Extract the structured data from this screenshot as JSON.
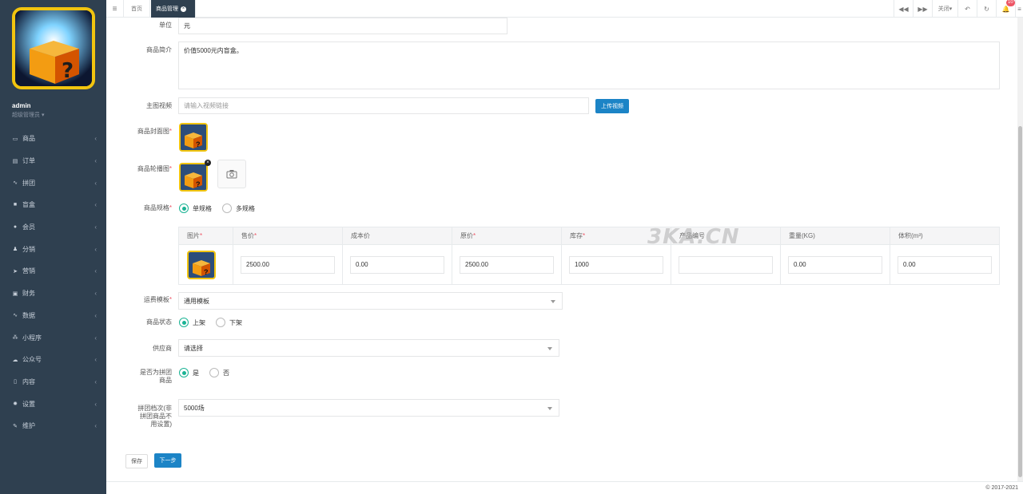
{
  "sidebar": {
    "user_name": "admin",
    "user_role": "超级管理员 ▾",
    "items": [
      {
        "label": "商品",
        "icon": "▭"
      },
      {
        "label": "订单",
        "icon": "▤"
      },
      {
        "label": "拼团",
        "icon": "∿"
      },
      {
        "label": "盲盒",
        "icon": "■"
      },
      {
        "label": "会员",
        "icon": "●"
      },
      {
        "label": "分销",
        "icon": "♟"
      },
      {
        "label": "营销",
        "icon": "➤"
      },
      {
        "label": "财务",
        "icon": "▣"
      },
      {
        "label": "数据",
        "icon": "∿"
      },
      {
        "label": "小程序",
        "icon": "⁂"
      },
      {
        "label": "公众号",
        "icon": "☁"
      },
      {
        "label": "内容",
        "icon": "▯"
      },
      {
        "label": "设置",
        "icon": "✹"
      },
      {
        "label": "维护",
        "icon": "✎"
      }
    ]
  },
  "topbar": {
    "menu_icon": "≡",
    "tab_home": "首页",
    "tab_active": "商品管理",
    "close_label": "关闭▾",
    "badge_count": "10"
  },
  "form": {
    "unit_label": "单位",
    "unit_value": "元",
    "intro_label": "商品简介",
    "intro_value": "价值5000元内盲盒。",
    "video_label": "主图视频",
    "video_placeholder": "请输入视频链接",
    "upload_video": "上传视频",
    "cover_label": "商品封面图",
    "carousel_label": "商品轮播图",
    "spec_label": "商品规格",
    "spec_single": "单规格",
    "spec_multi": "多规格",
    "shipping_label": "运费模板",
    "shipping_value": "通用模板",
    "status_label": "商品状态",
    "status_on": "上架",
    "status_off": "下架",
    "supplier_label": "供应商",
    "supplier_value": "请选择",
    "group_label_1": "是否为拼团",
    "group_label_2": "商品",
    "group_yes": "是",
    "group_no": "否",
    "tier_label_1": "拼团档次(非",
    "tier_label_2": "拼团商品不",
    "tier_label_3": "用设置)",
    "tier_value": "5000场",
    "save": "保存",
    "next": "下一步"
  },
  "spec_table": {
    "headers": [
      "图片",
      "售价",
      "成本价",
      "原价",
      "库存",
      "产品编号",
      "重量(KG)",
      "体积(m³)"
    ],
    "required": [
      true,
      true,
      false,
      true,
      true,
      false,
      false,
      false
    ],
    "values": [
      "2500.00",
      "0.00",
      "2500.00",
      "1000",
      "",
      "0.00",
      "0.00"
    ]
  },
  "watermark": "3KA.CN",
  "footer": "© 2017-2021"
}
